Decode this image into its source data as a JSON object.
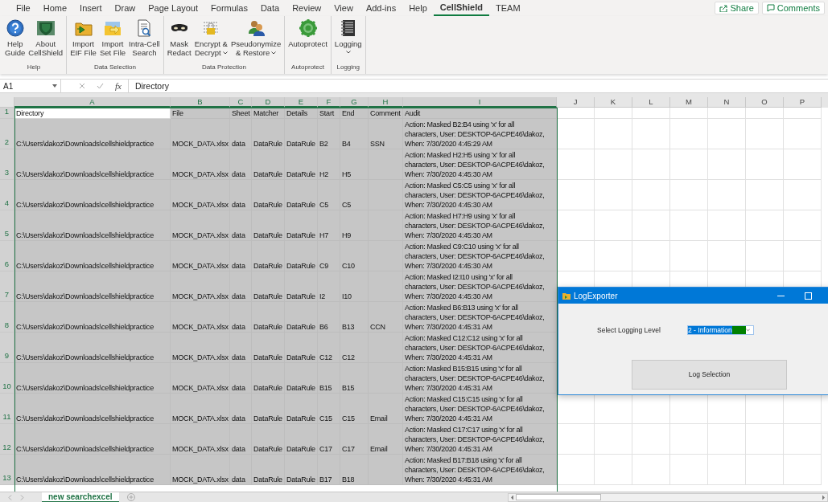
{
  "menu_tabs": [
    {
      "label": "File",
      "selected": false
    },
    {
      "label": "Home",
      "selected": false
    },
    {
      "label": "Insert",
      "selected": false
    },
    {
      "label": "Draw",
      "selected": false
    },
    {
      "label": "Page Layout",
      "selected": false
    },
    {
      "label": "Formulas",
      "selected": false
    },
    {
      "label": "Data",
      "selected": false
    },
    {
      "label": "Review",
      "selected": false
    },
    {
      "label": "View",
      "selected": false
    },
    {
      "label": "Add-ins",
      "selected": false
    },
    {
      "label": "Help",
      "selected": false
    },
    {
      "label": "CellShield",
      "selected": true
    },
    {
      "label": "TEAM",
      "selected": false
    }
  ],
  "top_buttons": [
    {
      "kind": "share",
      "label": "Share"
    },
    {
      "kind": "comments",
      "label": "Comments"
    }
  ],
  "ribbon_groups": [
    {
      "label": "Help",
      "buttons": [
        {
          "lines": [
            "Help",
            "Guide"
          ],
          "dropdown": false
        },
        {
          "lines": [
            "About",
            "CellShield"
          ],
          "dropdown": false
        }
      ]
    },
    {
      "label": "Data Selection",
      "buttons": [
        {
          "lines": [
            "Import",
            "EIF File"
          ],
          "dropdown": false
        },
        {
          "lines": [
            "Import",
            "Set File"
          ],
          "dropdown": false
        },
        {
          "lines": [
            "Intra-Cell",
            "Search"
          ],
          "dropdown": false
        }
      ]
    },
    {
      "label": "Data Protection",
      "buttons": [
        {
          "lines": [
            "Mask",
            "Redact"
          ],
          "dropdown": false
        },
        {
          "lines": [
            "Encrypt &",
            "Decrypt"
          ],
          "dropdown": true
        },
        {
          "lines": [
            "Pseudonymize",
            "& Restore"
          ],
          "dropdown": true
        }
      ]
    },
    {
      "label": "Autoprotect",
      "buttons": [
        {
          "lines": [
            "Autoprotect"
          ],
          "dropdown": false
        }
      ]
    },
    {
      "label": "Logging",
      "buttons": [
        {
          "lines": [
            "Logging"
          ],
          "dropdown": true
        }
      ]
    }
  ],
  "formula_bar": {
    "name_box": "A1",
    "function_label": "fx",
    "formula": "Directory"
  },
  "columns": [
    {
      "label": "A",
      "selected": true
    },
    {
      "label": "B",
      "selected": true
    },
    {
      "label": "C",
      "selected": true
    },
    {
      "label": "D",
      "selected": true
    },
    {
      "label": "E",
      "selected": true
    },
    {
      "label": "F",
      "selected": true
    },
    {
      "label": "G",
      "selected": true
    },
    {
      "label": "H",
      "selected": true
    },
    {
      "label": "I",
      "selected": true
    },
    {
      "label": "J",
      "selected": false
    },
    {
      "label": "K",
      "selected": false
    },
    {
      "label": "L",
      "selected": false
    },
    {
      "label": "M",
      "selected": false
    },
    {
      "label": "N",
      "selected": false
    },
    {
      "label": "O",
      "selected": false
    },
    {
      "label": "P",
      "selected": false
    }
  ],
  "rows": [
    {
      "number": "1",
      "selected": true,
      "first_cell_active": true,
      "cells": [
        "Directory",
        "File",
        "Sheet",
        "Matcher",
        "Details",
        "Start",
        "End",
        "Comment"
      ],
      "audit": [
        "Audit"
      ]
    },
    {
      "number": "2",
      "selected": true,
      "first_cell_active": false,
      "cells": [
        "C:\\Users\\dakoz\\Downloads\\cellshieldpractice",
        "MOCK_DATA.xlsx",
        "data",
        "DataRule",
        "DataRule",
        "B2",
        "B4",
        "SSN"
      ],
      "audit": [
        "Action: Masked B2:B4 using 'x' for all",
        "characters, User: DESKTOP-6ACPE46\\dakoz,",
        "When: 7/30/2020 4:45:29 AM"
      ]
    },
    {
      "number": "3",
      "selected": true,
      "first_cell_active": false,
      "cells": [
        "C:\\Users\\dakoz\\Downloads\\cellshieldpractice",
        "MOCK_DATA.xlsx",
        "data",
        "DataRule",
        "DataRule",
        "H2",
        "H5",
        null
      ],
      "audit": [
        "Action: Masked H2:H5 using 'x' for all",
        "characters, User: DESKTOP-6ACPE46\\dakoz,",
        "When: 7/30/2020 4:45:30 AM"
      ]
    },
    {
      "number": "4",
      "selected": true,
      "first_cell_active": false,
      "cells": [
        "C:\\Users\\dakoz\\Downloads\\cellshieldpractice",
        "MOCK_DATA.xlsx",
        "data",
        "DataRule",
        "DataRule",
        "C5",
        "C5",
        null
      ],
      "audit": [
        "Action: Masked C5:C5 using 'x' for all",
        "characters, User: DESKTOP-6ACPE46\\dakoz,",
        "When: 7/30/2020 4:45:30 AM"
      ]
    },
    {
      "number": "5",
      "selected": true,
      "first_cell_active": false,
      "cells": [
        "C:\\Users\\dakoz\\Downloads\\cellshieldpractice",
        "MOCK_DATA.xlsx",
        "data",
        "DataRule",
        "DataRule",
        "H7",
        "H9",
        null
      ],
      "audit": [
        "Action: Masked H7:H9 using 'x' for all",
        "characters, User: DESKTOP-6ACPE46\\dakoz,",
        "When: 7/30/2020 4:45:30 AM"
      ]
    },
    {
      "number": "6",
      "selected": true,
      "first_cell_active": false,
      "cells": [
        "C:\\Users\\dakoz\\Downloads\\cellshieldpractice",
        "MOCK_DATA.xlsx",
        "data",
        "DataRule",
        "DataRule",
        "C9",
        "C10",
        null
      ],
      "audit": [
        "Action: Masked C9:C10 using 'x' for all",
        "characters, User: DESKTOP-6ACPE46\\dakoz,",
        "When: 7/30/2020 4:45:30 AM"
      ]
    },
    {
      "number": "7",
      "selected": true,
      "first_cell_active": false,
      "cells": [
        "C:\\Users\\dakoz\\Downloads\\cellshieldpractice",
        "MOCK_DATA.xlsx",
        "data",
        "DataRule",
        "DataRule",
        "I2",
        "I10",
        null
      ],
      "audit": [
        "Action: Masked I2:I10 using 'x' for all",
        "characters, User: DESKTOP-6ACPE46\\dakoz,",
        "When: 7/30/2020 4:45:30 AM"
      ]
    },
    {
      "number": "8",
      "selected": true,
      "first_cell_active": false,
      "cells": [
        "C:\\Users\\dakoz\\Downloads\\cellshieldpractice",
        "MOCK_DATA.xlsx",
        "data",
        "DataRule",
        "DataRule",
        "B6",
        "B13",
        "CCN"
      ],
      "audit": [
        "Action: Masked B6:B13 using 'x' for all",
        "characters, User: DESKTOP-6ACPE46\\dakoz,",
        "When: 7/30/2020 4:45:31 AM"
      ]
    },
    {
      "number": "9",
      "selected": true,
      "first_cell_active": false,
      "cells": [
        "C:\\Users\\dakoz\\Downloads\\cellshieldpractice",
        "MOCK_DATA.xlsx",
        "data",
        "DataRule",
        "DataRule",
        "C12",
        "C12",
        null
      ],
      "audit": [
        "Action: Masked C12:C12 using 'x' for all",
        "characters, User: DESKTOP-6ACPE46\\dakoz,",
        "When: 7/30/2020 4:45:31 AM"
      ]
    },
    {
      "number": "10",
      "selected": true,
      "first_cell_active": false,
      "cells": [
        "C:\\Users\\dakoz\\Downloads\\cellshieldpractice",
        "MOCK_DATA.xlsx",
        "data",
        "DataRule",
        "DataRule",
        "B15",
        "B15",
        null
      ],
      "audit": [
        "Action: Masked B15:B15 using 'x' for all",
        "characters, User: DESKTOP-6ACPE46\\dakoz,",
        "When: 7/30/2020 4:45:31 AM"
      ]
    },
    {
      "number": "11",
      "selected": true,
      "first_cell_active": false,
      "cells": [
        "C:\\Users\\dakoz\\Downloads\\cellshieldpractice",
        "MOCK_DATA.xlsx",
        "data",
        "DataRule",
        "DataRule",
        "C15",
        "C15",
        "Email"
      ],
      "audit": [
        "Action: Masked C15:C15 using 'x' for all",
        "characters, User: DESKTOP-6ACPE46\\dakoz,",
        "When: 7/30/2020 4:45:31 AM"
      ]
    },
    {
      "number": "12",
      "selected": true,
      "first_cell_active": false,
      "cells": [
        "C:\\Users\\dakoz\\Downloads\\cellshieldpractice",
        "MOCK_DATA.xlsx",
        "data",
        "DataRule",
        "DataRule",
        "C17",
        "C17",
        "Email"
      ],
      "audit": [
        "Action: Masked C17:C17 using 'x' for all",
        "characters, User: DESKTOP-6ACPE46\\dakoz,",
        "When: 7/30/2020 4:45:31 AM"
      ]
    },
    {
      "number": "13",
      "selected": true,
      "first_cell_active": false,
      "cells": [
        "C:\\Users\\dakoz\\Downloads\\cellshieldpractice",
        "MOCK_DATA.xlsx",
        "data",
        "DataRule",
        "DataRule",
        "B17",
        "B18",
        null
      ],
      "audit": [
        "Action: Masked B17:B18 using 'x' for all",
        "characters, User: DESKTOP-6ACPE46\\dakoz,",
        "When: 7/30/2020 4:45:31 AM"
      ]
    }
  ],
  "sheet_tabs": [
    {
      "label": "new searchexcel",
      "selected": true
    }
  ],
  "dialog": {
    "title": "LogExporter",
    "field_label": "Select Logging Level",
    "level_value": "2 - Information",
    "button": "Log Selection"
  }
}
